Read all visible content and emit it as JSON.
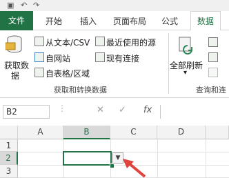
{
  "ribbon_tabs": {
    "file": "文件",
    "home": "开始",
    "insert": "插入",
    "layout": "页面布局",
    "formulas": "公式",
    "data": "数据"
  },
  "get_external_data": {
    "get_data_big": "获取数",
    "get_data_big_2": "据",
    "from_text": "从文本/CSV",
    "from_web": "自网站",
    "from_table": "自表格/区域",
    "recent_sources": "最近使用的源",
    "existing_connections": "现有连接",
    "group_label": "获取和转换数据"
  },
  "queries": {
    "refresh_all": "全部刷新",
    "group_label": "查询和连"
  },
  "formula_bar": {
    "name_box": "B2",
    "cancel": "✕",
    "enter": "✓",
    "fx": "fx"
  },
  "sheet": {
    "columns": [
      "A",
      "B",
      "C",
      "D"
    ],
    "rows": [
      "1",
      "2",
      "3"
    ]
  },
  "colors": {
    "brand": "#217346",
    "arrow": "#e0443e"
  },
  "icons": [
    "undo-icon",
    "redo-icon",
    "save-icon",
    "text-csv-icon",
    "web-icon",
    "table-icon",
    "recent-sources-icon",
    "connections-icon",
    "refresh-icon",
    "dropdown-arrow-icon"
  ]
}
